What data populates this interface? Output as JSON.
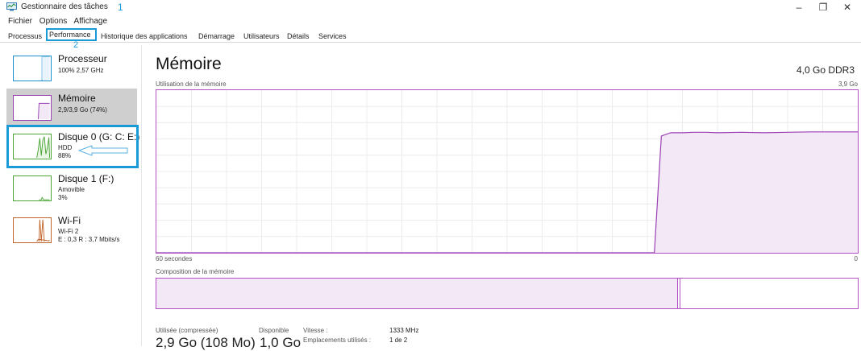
{
  "titlebar": {
    "title": "Gestionnaire des tâches",
    "annotation": "1",
    "minimize": "–",
    "restore": "❐",
    "close": "✕"
  },
  "menu": [
    "Fichier",
    "Options",
    "Affichage"
  ],
  "tabs": [
    {
      "label": "Processus",
      "selected": false
    },
    {
      "label": "Performance",
      "selected": true
    },
    {
      "label": "Historique des applications",
      "selected": false
    },
    {
      "label": "Démarrage",
      "selected": false
    },
    {
      "label": "Utilisateurs",
      "selected": false
    },
    {
      "label": "Détails",
      "selected": false
    },
    {
      "label": "Services",
      "selected": false
    }
  ],
  "tab_annotation": "2",
  "sidebar": [
    {
      "title": "Processeur",
      "sub1": "100% 2,57 GHz",
      "sub2": "",
      "icon": "cpu-graph-thumbnail",
      "color": "#1a8fd0",
      "selected": false
    },
    {
      "title": "Mémoire",
      "sub1": "2,9/3,9 Go (74%)",
      "sub2": "",
      "icon": "memory-graph-thumbnail",
      "color": "#9b3fb5",
      "selected": true
    },
    {
      "title": "Disque 0 (G: C: E:)",
      "sub1": "HDD",
      "sub2": "88%",
      "icon": "disk-graph-thumbnail",
      "color": "#4aa534",
      "selected": false
    },
    {
      "title": "Disque 1 (F:)",
      "sub1": "Amovible",
      "sub2": "3%",
      "icon": "disk-graph-thumbnail",
      "color": "#4aa534",
      "selected": false
    },
    {
      "title": "Wi-Fi",
      "sub1": "Wi-Fi 2",
      "sub2": "E : 0,3 R : 3,7 Mbits/s",
      "icon": "network-graph-thumbnail",
      "color": "#c1652b",
      "selected": false
    }
  ],
  "main": {
    "title": "Mémoire",
    "spec": "4,0 Go DDR3",
    "usage_label": "Utilisation de la mémoire",
    "usage_max": "3,9 Go",
    "time_left": "60 secondes",
    "time_right": "0",
    "composition_label": "Composition de la mémoire",
    "composition": {
      "in_use_fraction": 0.742,
      "modified_fraction": 0.003
    },
    "stats": {
      "used_label": "Utilisée (compressée)",
      "used_value": "2,9 Go (108 Mo)",
      "available_label": "Disponible",
      "available_value": "1,0 Go",
      "speed_label": "Vitesse :",
      "speed_value": "1333 MHz",
      "slots_label": "Emplacements utilisés :",
      "slots_value": "1 de 2"
    }
  },
  "colors": {
    "accent": "#1a9bd7",
    "memory": "#9b3fb5",
    "memory_fill": "#f3e8f5",
    "grid": "#ececec"
  },
  "chart_data": {
    "type": "area",
    "title": "Utilisation de la mémoire",
    "xlabel": "60 secondes",
    "x_reversed": true,
    "xlim": [
      60,
      0
    ],
    "ylim": [
      0,
      3.9
    ],
    "grid": true,
    "x": [
      60,
      57,
      54,
      51,
      48,
      45,
      42,
      39,
      36,
      33,
      30,
      27,
      24,
      21,
      18,
      17.4,
      16.8,
      16,
      15,
      14,
      13,
      12,
      10,
      8,
      6,
      4,
      2,
      0
    ],
    "values": [
      0,
      0,
      0,
      0,
      0,
      0,
      0,
      0,
      0,
      0,
      0,
      0,
      0,
      0,
      0,
      0,
      2.8,
      2.88,
      2.88,
      2.89,
      2.89,
      2.88,
      2.89,
      2.88,
      2.89,
      2.9,
      2.9,
      2.9
    ]
  }
}
